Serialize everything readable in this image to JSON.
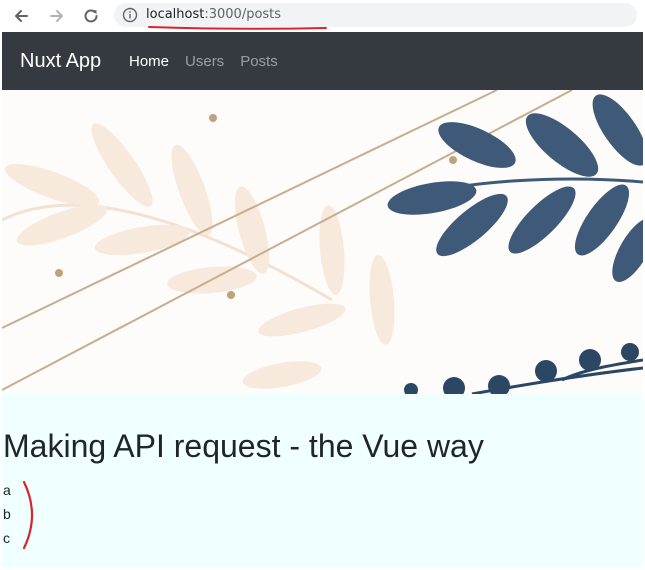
{
  "browser": {
    "url_host": "localhost",
    "url_path": ":3000/posts",
    "icons": [
      "back-arrow-icon",
      "forward-arrow-icon",
      "reload-icon",
      "info-icon"
    ],
    "annotation_color": "#d9232d"
  },
  "navbar": {
    "brand": "Nuxt App",
    "links": [
      {
        "label": "Home",
        "active": true
      },
      {
        "label": "Users",
        "active": false
      },
      {
        "label": "Posts",
        "active": false
      }
    ],
    "background": "#343a40"
  },
  "hero": {
    "image": "botanical-leaves-illustration"
  },
  "content": {
    "title": "Making API request - the Vue way",
    "items": [
      "a",
      "b",
      "c"
    ],
    "background": "#f0ffff"
  }
}
